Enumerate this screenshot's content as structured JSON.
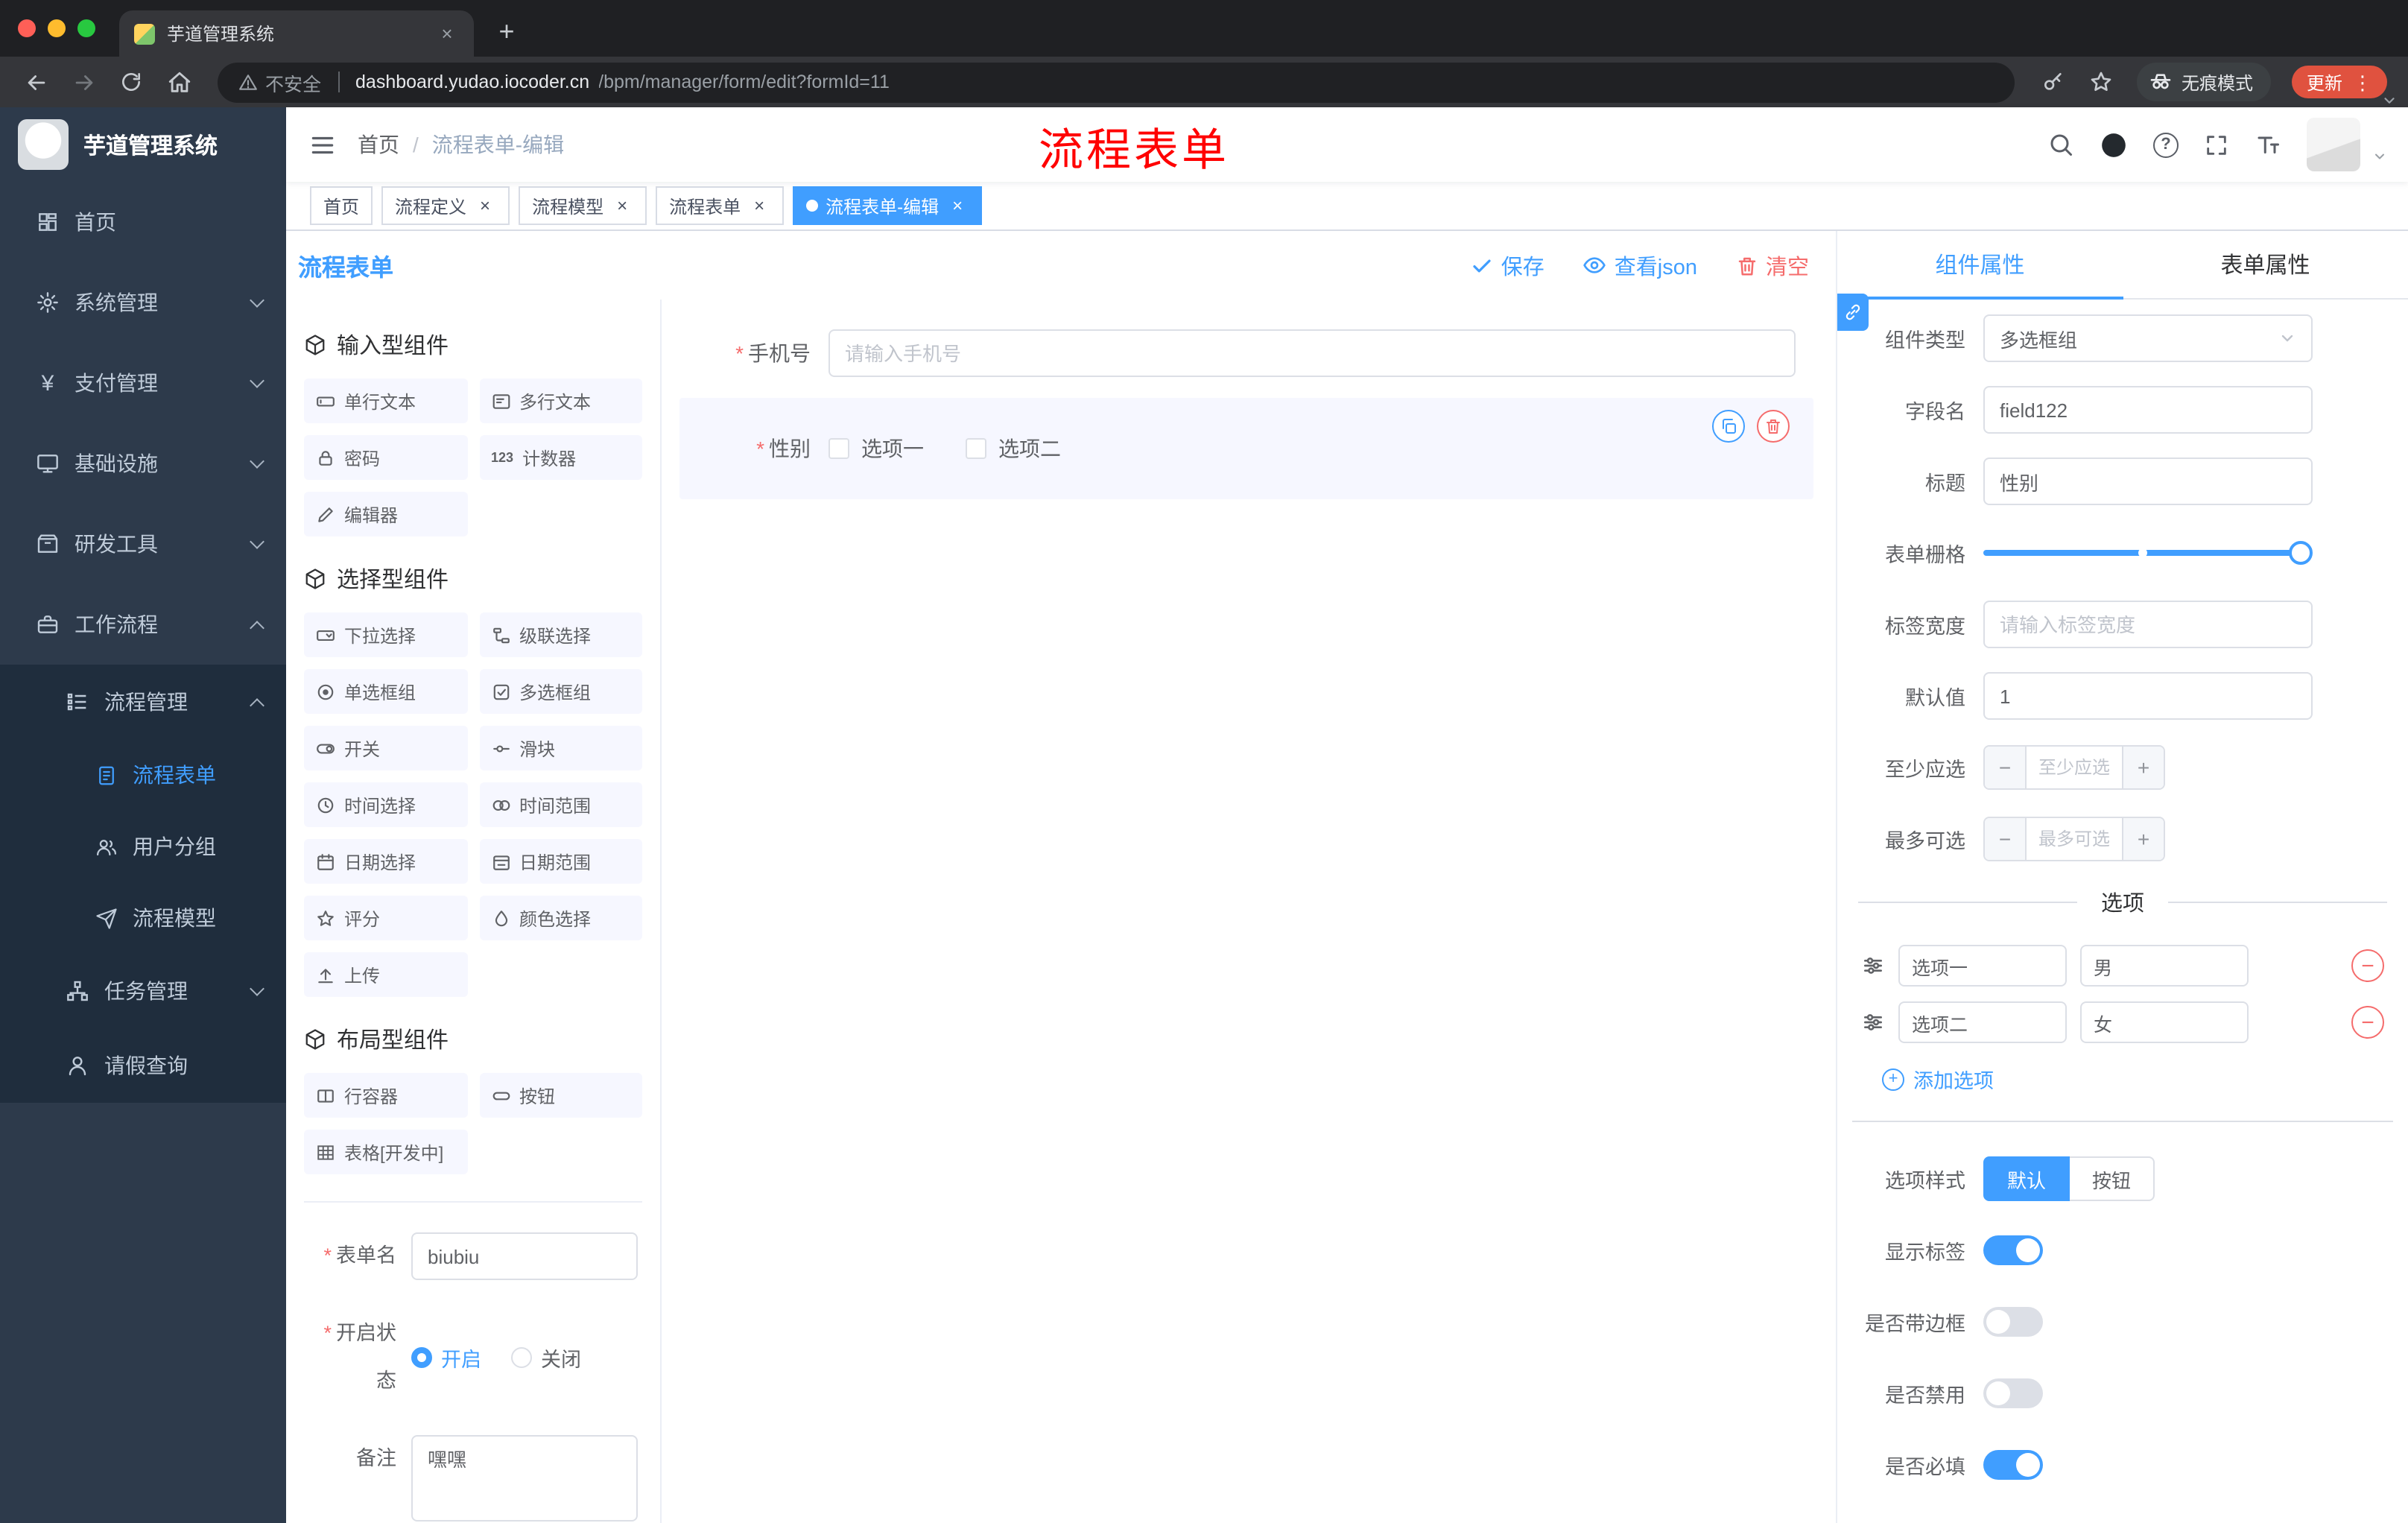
{
  "accent": {
    "primary": "#409eff",
    "danger": "#f56c6c",
    "annotation": "#ff0000"
  },
  "glyphs": {
    "plus": "+",
    "minus": "−",
    "close": "×",
    "more": "⋮",
    "question": "?",
    "counter": "123",
    "yen": "¥"
  },
  "browser": {
    "tab_title": "芋道管理系统",
    "security_label": "不安全",
    "url_host": "dashboard.yudao.iocoder.cn",
    "url_path": "/bpm/manager/form/edit?formId=11",
    "incognito_label": "无痕模式",
    "update_label": "更新"
  },
  "sidebar": {
    "logo_title": "芋道管理系统",
    "items": [
      {
        "label": "首页",
        "icon": "dashboard"
      },
      {
        "label": "系统管理",
        "icon": "gear"
      },
      {
        "label": "支付管理",
        "icon": "yen"
      },
      {
        "label": "基础设施",
        "icon": "monitor"
      },
      {
        "label": "研发工具",
        "icon": "toolbox"
      },
      {
        "label": "工作流程",
        "icon": "briefcase"
      },
      {
        "label": "流程管理",
        "icon": "list-tree"
      },
      {
        "label": "流程表单",
        "icon": "document"
      },
      {
        "label": "用户分组",
        "icon": "users"
      },
      {
        "label": "流程模型",
        "icon": "paper-plane"
      },
      {
        "label": "任务管理",
        "icon": "org-tree"
      },
      {
        "label": "请假查询",
        "icon": "user"
      }
    ]
  },
  "navbar": {
    "breadcrumb": [
      "首页",
      "流程表单-编辑"
    ],
    "separator": "/",
    "annotation": "流程表单"
  },
  "tags": [
    {
      "label": "首页"
    },
    {
      "label": "流程定义"
    },
    {
      "label": "流程模型"
    },
    {
      "label": "流程表单"
    },
    {
      "label": "流程表单-编辑"
    }
  ],
  "designer": {
    "title": "流程表单",
    "save": "保存",
    "view_json": "查看json",
    "clear": "清空"
  },
  "palette": {
    "sections": [
      {
        "title": "输入型组件",
        "items": [
          {
            "label": "单行文本"
          },
          {
            "label": "多行文本"
          },
          {
            "label": "密码"
          },
          {
            "label": "计数器"
          },
          {
            "label": "编辑器"
          }
        ]
      },
      {
        "title": "选择型组件",
        "items": [
          {
            "label": "下拉选择"
          },
          {
            "label": "级联选择"
          },
          {
            "label": "单选框组"
          },
          {
            "label": "多选框组"
          },
          {
            "label": "开关"
          },
          {
            "label": "滑块"
          },
          {
            "label": "时间选择"
          },
          {
            "label": "时间范围"
          },
          {
            "label": "日期选择"
          },
          {
            "label": "日期范围"
          },
          {
            "label": "评分"
          },
          {
            "label": "颜色选择"
          },
          {
            "label": "上传"
          }
        ]
      },
      {
        "title": "布局型组件",
        "items": [
          {
            "label": "行容器"
          },
          {
            "label": "按钮"
          },
          {
            "label": "表格[开发中]"
          }
        ]
      }
    ],
    "form": {
      "name_label": "表单名",
      "name_value": "biubiu",
      "status_label": "开启状态",
      "status_on": "开启",
      "status_off": "关闭",
      "status_selected": "开启",
      "remark_label": "备注",
      "remark_value": "嘿嘿"
    }
  },
  "canvas": {
    "phone_label": "手机号",
    "phone_placeholder": "请输入手机号",
    "gender_label": "性别",
    "gender_options": [
      "选项一",
      "选项二"
    ]
  },
  "props": {
    "tab_component": "组件属性",
    "tab_form": "表单属性",
    "component_type_label": "组件类型",
    "component_type_value": "多选框组",
    "field_name_label": "字段名",
    "field_name_value": "field122",
    "title_label": "标题",
    "title_value": "性别",
    "grid_label": "表单栅格",
    "label_width_label": "标签宽度",
    "label_width_placeholder": "请输入标签宽度",
    "default_label": "默认值",
    "default_value": "1",
    "min_label": "至少应选",
    "min_placeholder": "至少应选",
    "max_label": "最多可选",
    "max_placeholder": "最多可选",
    "options_divider": "选项",
    "options": [
      {
        "name": "选项一",
        "value": "男"
      },
      {
        "name": "选项二",
        "value": "女"
      }
    ],
    "add_option": "添加选项",
    "option_style_label": "选项样式",
    "option_style_default": "默认",
    "option_style_button": "按钮",
    "option_style_selected": "默认",
    "show_label": "显示标签",
    "show_label_on": true,
    "border_label": "是否带边框",
    "border_on": false,
    "disabled_label": "是否禁用",
    "disabled_on": false,
    "required_label": "是否必填",
    "required_on": true
  }
}
